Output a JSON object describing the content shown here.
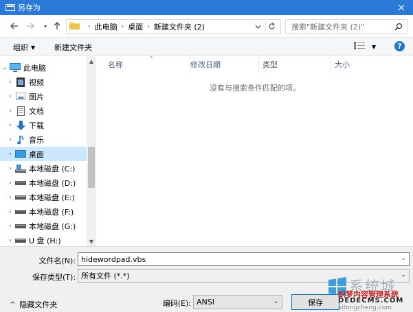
{
  "window": {
    "title": "另存为"
  },
  "nav": {
    "breadcrumbs": [
      "此电脑",
      "桌面",
      "新建文件夹 (2)"
    ],
    "search_placeholder": "搜索\"新建文件夹 (2)\""
  },
  "toolbar": {
    "organize": "组织",
    "new_folder": "新建文件夹"
  },
  "tree": {
    "items": [
      {
        "label": "此电脑",
        "icon": "computer-icon"
      },
      {
        "label": "视频",
        "icon": "video-icon"
      },
      {
        "label": "图片",
        "icon": "pictures-icon"
      },
      {
        "label": "文档",
        "icon": "documents-icon"
      },
      {
        "label": "下载",
        "icon": "download-icon"
      },
      {
        "label": "音乐",
        "icon": "music-icon"
      },
      {
        "label": "桌面",
        "icon": "desktop-icon"
      },
      {
        "label": "本地磁盘 (C:)",
        "icon": "system-drive-icon"
      },
      {
        "label": "本地磁盘 (D:)",
        "icon": "drive-icon"
      },
      {
        "label": "本地磁盘 (E:)",
        "icon": "drive-icon"
      },
      {
        "label": "本地磁盘 (F:)",
        "icon": "drive-icon"
      },
      {
        "label": "本地磁盘 (G:)",
        "icon": "drive-icon"
      },
      {
        "label": "U 盘 (H:)",
        "icon": "usb-drive-icon"
      }
    ]
  },
  "list": {
    "columns": [
      "名称",
      "修改日期",
      "类型",
      "大小"
    ],
    "empty_message": "没有与搜索条件匹配的项。"
  },
  "form": {
    "filename_label": "文件名(N):",
    "filename_value": "hidewordpad.vbs",
    "filetype_label": "保存类型(T):",
    "filetype_value": "所有文件 (*.*)",
    "encoding_label": "编码(E):",
    "encoding_value": "ANSI",
    "hide_folders": "隐藏文件夹",
    "save_button": "保存"
  },
  "watermark": {
    "big": "系统城",
    "red": "织梦内容管理系统",
    "url": "DEDECMS.COM",
    "small": "xitongcheng.com"
  },
  "colors": {
    "titlebar": "#2b79d8",
    "selection": "#cce8ff",
    "folder": "#ffd766",
    "help": "#1979ca"
  }
}
